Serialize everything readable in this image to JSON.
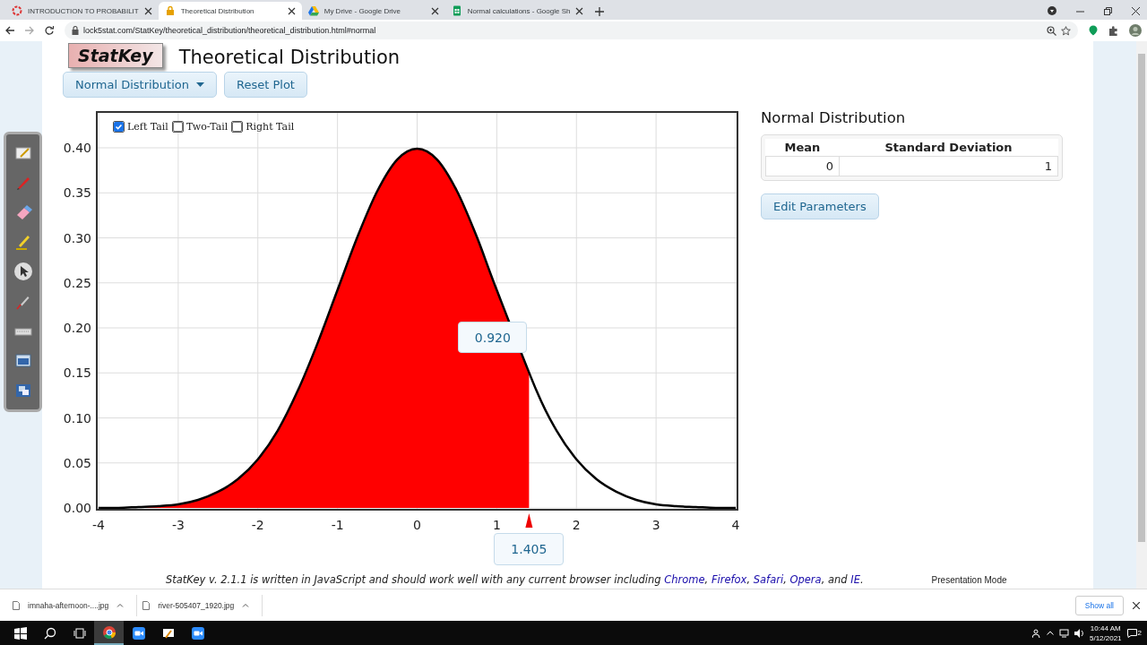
{
  "browser": {
    "tabs": [
      {
        "title": "INTRODUCTION TO PROBABILIT",
        "kind": "web",
        "selected": false
      },
      {
        "title": "Theoretical Distribution",
        "kind": "lock",
        "selected": true
      },
      {
        "title": "My Drive - Google Drive",
        "kind": "drive",
        "selected": false
      },
      {
        "title": "Normal calculations - Google Sh",
        "kind": "sheet",
        "selected": false
      }
    ],
    "address": "lock5stat.com/StatKey/theoretical_distribution/theoretical_distribution.html#normal"
  },
  "page": {
    "logo": "StatKey",
    "heading": "Theoretical Distribution",
    "distribution_menu": "Normal Distribution",
    "reset_button": "Reset Plot",
    "tails": [
      {
        "label": "Left Tail",
        "checked": true
      },
      {
        "label": "Two-Tail",
        "checked": false
      },
      {
        "label": "Right Tail",
        "checked": false
      }
    ],
    "chart_data": {
      "type": "area",
      "x": [
        -4,
        -3.75,
        -3.5,
        -3.25,
        -3,
        -2.75,
        -2.5,
        -2.25,
        -2,
        -1.75,
        -1.5,
        -1.25,
        -1,
        -0.75,
        -0.5,
        -0.25,
        0,
        0.25,
        0.5,
        0.75,
        1,
        1.25,
        1.5,
        1.75,
        2,
        2.25,
        2.5,
        2.75,
        3,
        3.25,
        3.5,
        3.75,
        4
      ],
      "grid": true,
      "series": [
        {
          "color": "#000000",
          "values": [
            0,
            0,
            0.001,
            0.002,
            0.004,
            0.009,
            0.018,
            0.032,
            0.054,
            0.086,
            0.13,
            0.183,
            0.242,
            0.301,
            0.352,
            0.387,
            0.399,
            0.387,
            0.352,
            0.301,
            0.242,
            null,
            0.13,
            0.086,
            0.054,
            0.032,
            0.018,
            0.009,
            0.004,
            0.002,
            0.001,
            0,
            0
          ]
        }
      ],
      "xlim": [
        -4,
        4
      ],
      "ylim": [
        0,
        0.4
      ],
      "xticks": [
        -4,
        -3,
        -2,
        -1,
        0,
        1,
        2,
        3,
        4
      ],
      "yticks": [
        {
          "value": 0,
          "label": "0.00"
        },
        {
          "value": 0.05,
          "label": "0.05"
        },
        {
          "value": 0.1,
          "label": "0.10"
        },
        {
          "value": 0.15,
          "label": "0.15"
        },
        {
          "value": 0.2,
          "label": "0.20"
        },
        {
          "value": 0.25,
          "label": "0.25"
        },
        {
          "value": 0.3,
          "label": "0.30"
        },
        {
          "value": 0.35,
          "label": "0.35"
        },
        {
          "value": 0.4,
          "label": "0.40"
        }
      ]
    },
    "cutoff": "1.405",
    "tail_area": "0.920",
    "parameters": {
      "title": "Normal Distribution",
      "columns": [
        "Mean",
        "Standard Deviation"
      ],
      "values": [
        "0",
        "1"
      ],
      "edit_button": "Edit Parameters"
    },
    "footer": [
      {
        "kind": "text",
        "text": "StatKey v. 2.1.1 is written in JavaScript and should work well with any current browser including "
      },
      {
        "kind": "link",
        "text": "Chrome"
      },
      {
        "kind": "text",
        "text": ", "
      },
      {
        "kind": "link",
        "text": "Firefox"
      },
      {
        "kind": "text",
        "text": ", "
      },
      {
        "kind": "link",
        "text": "Safari"
      },
      {
        "kind": "text",
        "text": ", "
      },
      {
        "kind": "link",
        "text": "Opera"
      },
      {
        "kind": "text",
        "text": ", and "
      },
      {
        "kind": "link",
        "text": "IE"
      },
      {
        "kind": "text",
        "text": "."
      }
    ],
    "presentation_mode": "Presentation Mode"
  },
  "annotation_tools": [
    {
      "kind": "board",
      "selected": false
    },
    {
      "kind": "pen",
      "selected": false
    },
    {
      "kind": "eraser",
      "selected": false
    },
    {
      "kind": "highlighter",
      "selected": false
    },
    {
      "kind": "pointer",
      "selected": true
    },
    {
      "kind": "laser",
      "selected": false
    },
    {
      "kind": "keyboard",
      "selected": false
    },
    {
      "kind": "screen",
      "selected": false
    },
    {
      "kind": "windows",
      "selected": false
    }
  ],
  "downloads": {
    "items": [
      "imnaha-afternoon-....jpg",
      "river-505407_1920.jpg"
    ],
    "show_all": "Show all"
  },
  "taskbar": {
    "apps": [
      {
        "kind": "chrome",
        "selected": true
      },
      {
        "kind": "zoom",
        "selected": false
      },
      {
        "kind": "whiteboard",
        "selected": false
      },
      {
        "kind": "zoom",
        "selected": false
      }
    ],
    "time": "10:44 AM",
    "date": "5/12/2021",
    "notifications": "2"
  }
}
